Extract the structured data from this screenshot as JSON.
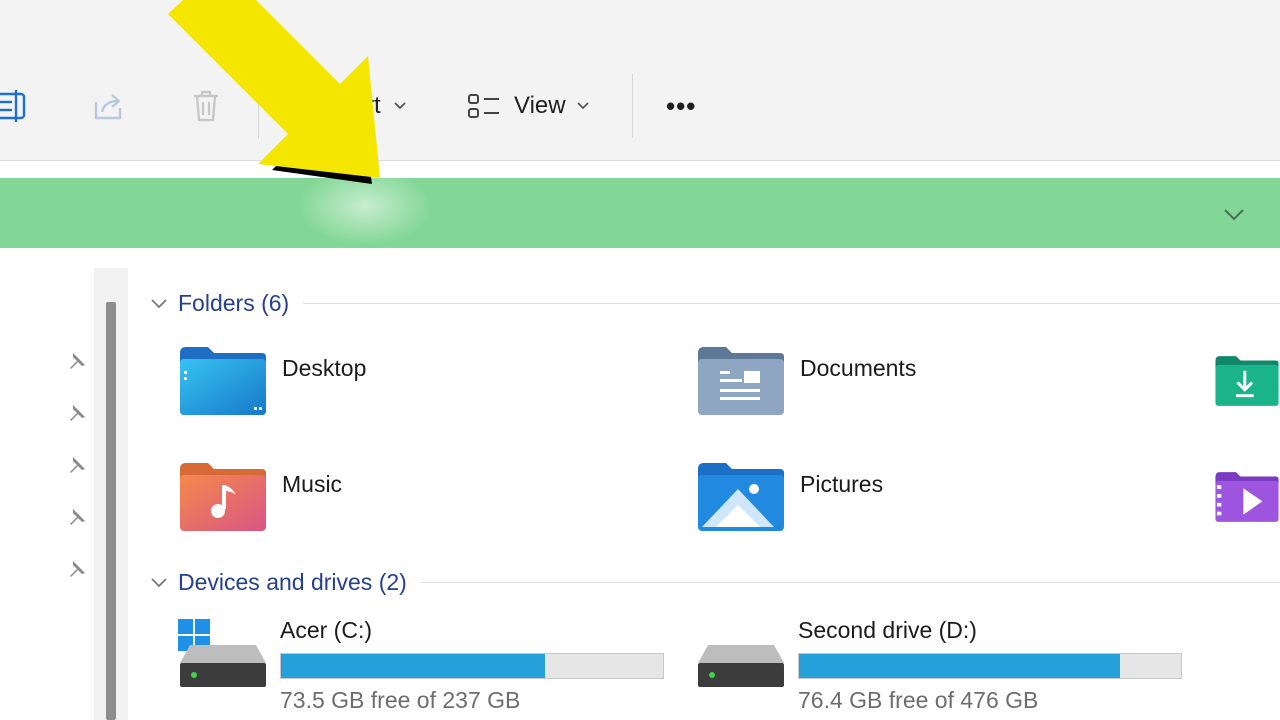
{
  "toolbar": {
    "icons": [
      "rename-icon",
      "share-icon",
      "delete-icon"
    ],
    "sort_label_partial": "rt",
    "view_label": "View",
    "more_label": "•••"
  },
  "address_bar": {
    "highlight_color": "#83d796",
    "chevron_icon": "chevron-down-icon"
  },
  "nav": {
    "pinned_count": 5,
    "pin_icon": "pin-icon"
  },
  "content": {
    "folders_section": {
      "title": "Folders (6)",
      "items": [
        {
          "label": "Desktop",
          "icon": "desktop-folder-icon"
        },
        {
          "label": "Documents",
          "icon": "documents-folder-icon"
        },
        {
          "label": "",
          "icon": "downloads-folder-icon"
        },
        {
          "label": "Music",
          "icon": "music-folder-icon"
        },
        {
          "label": "Pictures",
          "icon": "pictures-folder-icon"
        },
        {
          "label": "",
          "icon": "videos-folder-icon"
        }
      ]
    },
    "drives_section": {
      "title": "Devices and drives (2)",
      "drives": [
        {
          "name": "Acer (C:)",
          "free_text": "73.5 GB free of 237 GB",
          "used_fraction": 0.69,
          "icon": "windows-drive-icon"
        },
        {
          "name": "Second drive (D:)",
          "free_text": "76.4 GB free of 476 GB",
          "used_fraction": 0.84,
          "icon": "drive-icon"
        }
      ]
    }
  },
  "colors": {
    "accent_text": "#24408e",
    "drive_bar": "#26a0da",
    "arrow_fill": "#f5e600"
  }
}
